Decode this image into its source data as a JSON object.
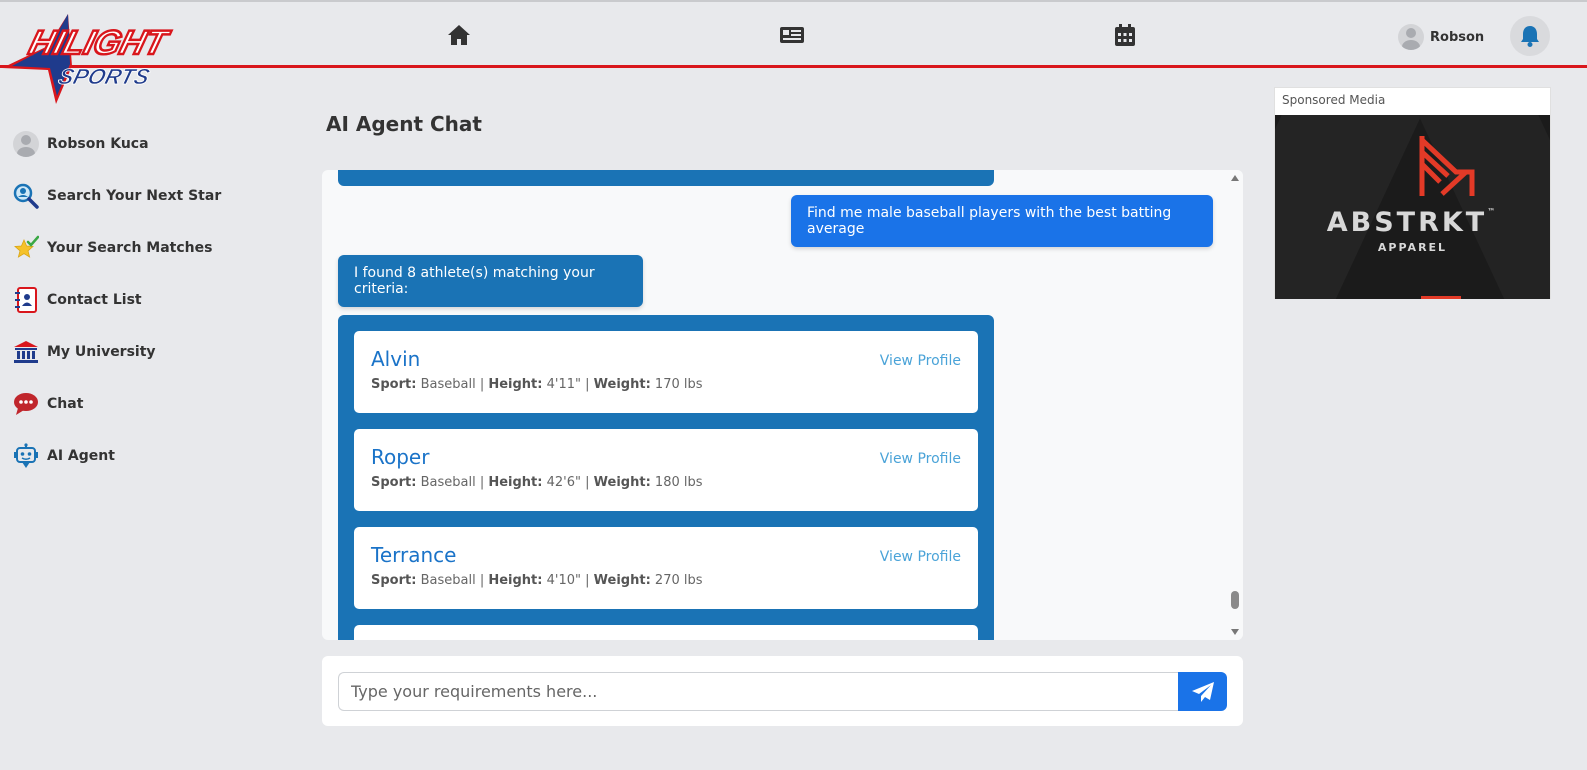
{
  "brand": {
    "logo_line1": "HILIGHT",
    "logo_line2": "SPORTS",
    "accent_color": "#d9161c",
    "primary_color": "#1a73e8"
  },
  "topnav": {
    "items": [
      {
        "icon": "home-icon"
      },
      {
        "icon": "news-icon"
      },
      {
        "icon": "calendar-icon"
      }
    ],
    "user_name": "Robson",
    "notification_icon": "bell-icon"
  },
  "sidebar": {
    "items": [
      {
        "label": "Robson Kuca",
        "icon": "avatar"
      },
      {
        "label": "Search Your Next Star",
        "icon": "search-icon"
      },
      {
        "label": "Your Search Matches",
        "icon": "star-check-icon"
      },
      {
        "label": "Contact List",
        "icon": "contact-book-icon"
      },
      {
        "label": "My University",
        "icon": "university-icon"
      },
      {
        "label": "Chat",
        "icon": "chat-bubble-icon"
      },
      {
        "label": "AI Agent",
        "icon": "robot-icon"
      }
    ]
  },
  "main": {
    "title": "AI Agent Chat",
    "messages": {
      "user_query": "Find me male baseball players with the best batting average",
      "bot_reply": "I found 8 athlete(s) matching your criteria:"
    },
    "results": [
      {
        "name": "Alvin",
        "sport_label": "Sport:",
        "sport": "Baseball",
        "height_label": "Height:",
        "height": "4'11\"",
        "weight_label": "Weight:",
        "weight": "170 lbs",
        "action": "View Profile"
      },
      {
        "name": "Roper",
        "sport_label": "Sport:",
        "sport": "Baseball",
        "height_label": "Height:",
        "height": "42'6\"",
        "weight_label": "Weight:",
        "weight": "180 lbs",
        "action": "View Profile"
      },
      {
        "name": "Terrance",
        "sport_label": "Sport:",
        "sport": "Baseball",
        "height_label": "Height:",
        "height": "4'10\"",
        "weight_label": "Weight:",
        "weight": "270 lbs",
        "action": "View Profile"
      }
    ],
    "input": {
      "placeholder": "Type your requirements here...",
      "value": "",
      "send_icon": "send-icon"
    }
  },
  "sponsor": {
    "label": "Sponsored Media",
    "ad_brand": "ABSTRKT",
    "ad_tm": "™",
    "ad_sub": "APPAREL"
  }
}
